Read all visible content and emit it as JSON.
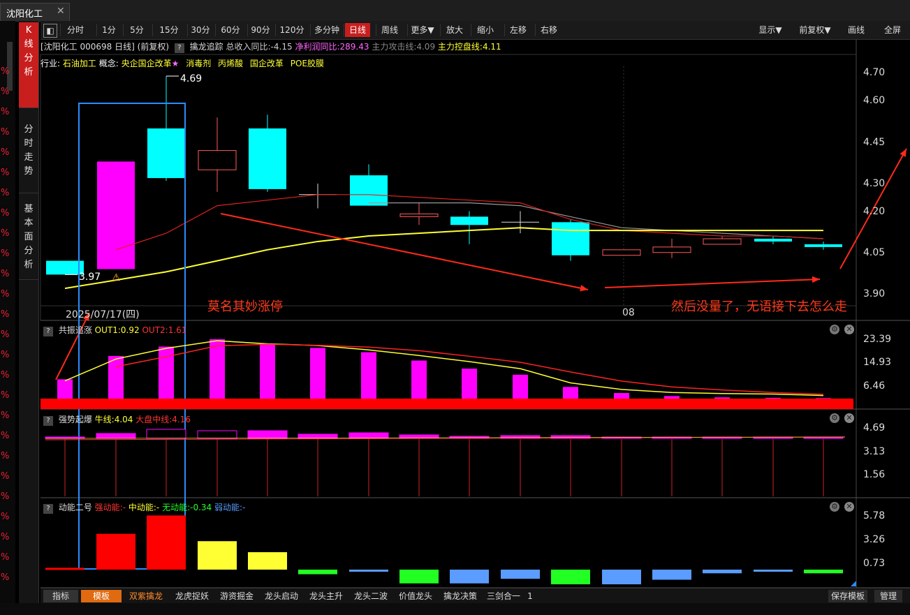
{
  "window": {
    "tab_title": "沈阳化工",
    "close_glyph": "✕"
  },
  "left_gutter": {
    "pct_glyph": "%"
  },
  "vertical_tabs": [
    {
      "label": "K\n线\n分\n析"
    },
    {
      "label": "分\n时\n走\n势"
    },
    {
      "label": "基\n本\n面\n分\n析"
    }
  ],
  "toolbar": {
    "items": [
      "分时",
      "1分",
      "5分",
      "15分",
      "30分",
      "60分",
      "90分",
      "120分",
      "多分钟",
      "日线",
      "周线",
      "更多▼",
      "放大",
      "缩小",
      "左移",
      "右移"
    ],
    "selected": "日线",
    "right_items": [
      "显示▼",
      "前复权▼",
      "画线",
      "全屏"
    ]
  },
  "info": {
    "stock": "[沈阳化工 000698 日线]",
    "adjust": "(前复权)",
    "indicator": "擒龙追踪",
    "revenue_yoy": "总收入同比:-4.15",
    "profit_yoy": "净利润同比:289.43",
    "attack_line": "主力攻击线:4.09",
    "control_line": "主力控盘线:4.11"
  },
  "concepts": {
    "industry_label": "行业:",
    "industry": "石油加工",
    "concept_label": "概念:",
    "items": [
      "央企国企改革",
      "消毒剂",
      "丙烯酸",
      "国企改革",
      "POE胶膜"
    ],
    "star": "★"
  },
  "main_chart": {
    "y_ticks": [
      "4.70",
      "4.60",
      "4.45",
      "4.30",
      "4.20",
      "4.05",
      "3.90"
    ],
    "high_label": "4.69",
    "low_label": "3.97",
    "date_label": "2025/07/17(四)",
    "month_label": "08",
    "annotation_left": "莫名其妙涨停",
    "annotation_right": "然后没量了，无语接下去怎么走",
    "colors": {
      "up": "#ff00ff",
      "down": "#00ffff",
      "ma_yellow": "#ffff33",
      "ma_red": "#dd2222",
      "ma_gray": "#9a9a9a",
      "arrow": "#ff2a1a",
      "box": "#2a8cff"
    }
  },
  "pane_resonance": {
    "title": "共振追涨",
    "out1": "OUT1:0.92",
    "out2": "OUT2:1.61",
    "y_ticks": [
      "23.39",
      "14.93",
      "6.46"
    ]
  },
  "pane_strong": {
    "title": "强势起爆",
    "bull": "牛线:4.04",
    "market": "大盘中线:4.16",
    "y_ticks": [
      "4.69",
      "3.13",
      "1.56"
    ]
  },
  "pane_energy": {
    "title": "动能二号",
    "strong": "强动能:-",
    "mid": "中动能:-",
    "none": "无动能:-0.34",
    "weak": "弱动能:-",
    "y_ticks": [
      "5.78",
      "3.26",
      "0.73"
    ]
  },
  "bottom_bar": {
    "items": [
      "指标",
      "模板",
      "双紫擒龙",
      "龙虎捉妖",
      "游资掘金",
      "龙头启动",
      "龙头主升",
      "龙头二波",
      "价值龙头",
      "擒龙决策",
      "三剑合一",
      "1"
    ],
    "right": [
      "保存模板",
      "管理"
    ]
  }
}
